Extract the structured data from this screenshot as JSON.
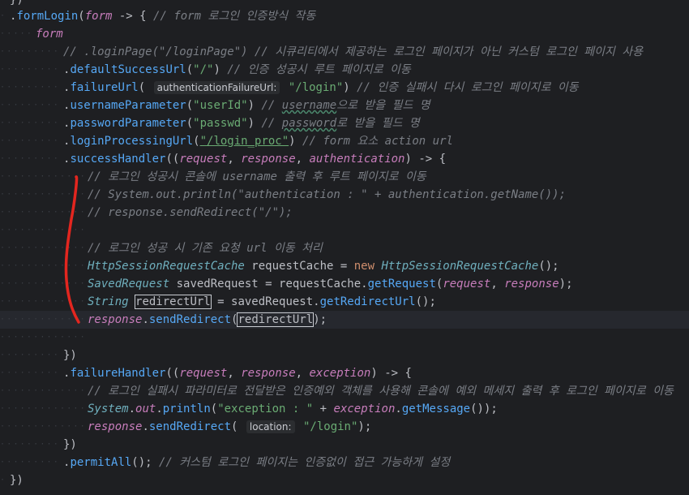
{
  "code_lines": [
    {
      "id": "l0",
      "parts": [
        {
          "t": "})",
          "c": "c-var"
        }
      ]
    },
    {
      "id": "l1",
      "parts": [
        {
          "t": ".",
          "c": "c-var"
        },
        {
          "t": "formLogin",
          "c": "c-meth"
        },
        {
          "t": "(",
          "c": "c-var"
        },
        {
          "t": "form",
          "c": "c-param"
        },
        {
          "t": " -> { ",
          "c": "c-var"
        },
        {
          "t": "// form 로그인 인증방식 작동",
          "c": "c-cmt"
        }
      ]
    },
    {
      "id": "l2",
      "parts": [
        {
          "t": "form",
          "c": "c-param"
        }
      ]
    },
    {
      "id": "l3",
      "parts": [
        {
          "t": "// .loginPage(\"/loginPage\") // 시큐리티에서 제공하는 로그인 페이지가 아닌 커스텀 로그인 페이지 사용",
          "c": "c-cmt"
        }
      ]
    },
    {
      "id": "l4",
      "parts": [
        {
          "t": ".",
          "c": "c-var"
        },
        {
          "t": "defaultSuccessUrl",
          "c": "c-meth"
        },
        {
          "t": "(",
          "c": "c-var"
        },
        {
          "t": "\"/\"",
          "c": "c-str"
        },
        {
          "t": ") ",
          "c": "c-var"
        },
        {
          "t": "// 인증 성공시 루트 페이지로 이동",
          "c": "c-cmt"
        }
      ]
    },
    {
      "id": "l5",
      "parts": [
        {
          "t": ".",
          "c": "c-var"
        },
        {
          "t": "failureUrl",
          "c": "c-meth"
        },
        {
          "t": "( ",
          "c": "c-var"
        },
        {
          "hint": "authenticationFailureUrl:"
        },
        {
          "t": " \"/login\"",
          "c": "c-str"
        },
        {
          "t": ") ",
          "c": "c-var"
        },
        {
          "t": "// 인증 실패시 다시 로그인 페이지로 이동",
          "c": "c-cmt"
        }
      ]
    },
    {
      "id": "l6",
      "parts": [
        {
          "t": ".",
          "c": "c-var"
        },
        {
          "t": "usernameParameter",
          "c": "c-meth"
        },
        {
          "t": "(",
          "c": "c-var"
        },
        {
          "t": "\"userId\"",
          "c": "c-str"
        },
        {
          "t": ") ",
          "c": "c-var"
        },
        {
          "t": "// ",
          "c": "c-cmt"
        },
        {
          "t": "username",
          "c": "c-cmt wavy"
        },
        {
          "t": "으로 받을 필드 명",
          "c": "c-cmt"
        }
      ]
    },
    {
      "id": "l7",
      "parts": [
        {
          "t": ".",
          "c": "c-var"
        },
        {
          "t": "passwordParameter",
          "c": "c-meth"
        },
        {
          "t": "(",
          "c": "c-var"
        },
        {
          "t": "\"passwd\"",
          "c": "c-str"
        },
        {
          "t": ") ",
          "c": "c-var"
        },
        {
          "t": "// ",
          "c": "c-cmt"
        },
        {
          "t": "password",
          "c": "c-cmt wavy"
        },
        {
          "t": "로 받을 필드 명",
          "c": "c-cmt"
        }
      ]
    },
    {
      "id": "l8",
      "parts": [
        {
          "t": ".",
          "c": "c-var"
        },
        {
          "t": "loginProcessingUrl",
          "c": "c-meth"
        },
        {
          "t": "(",
          "c": "c-var"
        },
        {
          "t": "\"/login_proc\"",
          "c": "c-str under"
        },
        {
          "t": ") ",
          "c": "c-var"
        },
        {
          "t": "// form 요소 action url",
          "c": "c-cmt"
        }
      ]
    },
    {
      "id": "l9",
      "parts": [
        {
          "t": ".",
          "c": "c-var"
        },
        {
          "t": "successHandler",
          "c": "c-meth"
        },
        {
          "t": "((",
          "c": "c-var"
        },
        {
          "t": "request",
          "c": "c-param"
        },
        {
          "t": ", ",
          "c": "c-var"
        },
        {
          "t": "response",
          "c": "c-param"
        },
        {
          "t": ", ",
          "c": "c-var"
        },
        {
          "t": "authentication",
          "c": "c-param"
        },
        {
          "t": ") -> {",
          "c": "c-var"
        }
      ]
    },
    {
      "id": "l10",
      "parts": [
        {
          "t": "// 로그인 성공시 콘솔에 username 출력 후 루트 페이지로 이동",
          "c": "c-cmt"
        }
      ]
    },
    {
      "id": "l11",
      "parts": [
        {
          "t": "// System.out.println(\"authentication : \" + authentication.getName());",
          "c": "c-cmt"
        }
      ]
    },
    {
      "id": "l12",
      "parts": [
        {
          "t": "// response.sendRedirect(\"/\");",
          "c": "c-cmt"
        }
      ]
    },
    {
      "id": "l13",
      "parts": []
    },
    {
      "id": "l14",
      "parts": [
        {
          "t": "// 로그인 성공 시 기존 요청 url 이동 처리",
          "c": "c-cmt"
        }
      ]
    },
    {
      "id": "l15",
      "parts": [
        {
          "t": "HttpSessionRequestCache",
          "c": "c-cls"
        },
        {
          "t": " requestCache = ",
          "c": "c-var"
        },
        {
          "t": "new ",
          "c": "c-key"
        },
        {
          "t": "HttpSessionRequestCache",
          "c": "c-cls"
        },
        {
          "t": "();",
          "c": "c-var"
        }
      ]
    },
    {
      "id": "l16",
      "parts": [
        {
          "t": "SavedRequest",
          "c": "c-cls"
        },
        {
          "t": " savedRequest = requestCache.",
          "c": "c-var"
        },
        {
          "t": "getRequest",
          "c": "c-meth"
        },
        {
          "t": "(",
          "c": "c-var"
        },
        {
          "t": "request",
          "c": "c-param"
        },
        {
          "t": ", ",
          "c": "c-var"
        },
        {
          "t": "response",
          "c": "c-param"
        },
        {
          "t": ");",
          "c": "c-var"
        }
      ]
    },
    {
      "id": "l17",
      "parts": [
        {
          "t": "String",
          "c": "c-cls"
        },
        {
          "t": " ",
          "c": "c-var"
        },
        {
          "t": "redirectUrl",
          "c": "c-var boxed"
        },
        {
          "t": " = savedRequest.",
          "c": "c-var"
        },
        {
          "t": "getRedirectUrl",
          "c": "c-meth"
        },
        {
          "t": "();",
          "c": "c-var"
        }
      ]
    },
    {
      "id": "l18",
      "parts": [
        {
          "t": "response",
          "c": "c-param"
        },
        {
          "t": ".",
          "c": "c-var"
        },
        {
          "t": "sendRedirect",
          "c": "c-meth"
        },
        {
          "t": "(",
          "c": "c-var"
        },
        {
          "t": "redirectUrl",
          "c": "c-var boxed"
        },
        {
          "t": ");",
          "c": "c-var"
        }
      ]
    },
    {
      "id": "l19",
      "parts": []
    },
    {
      "id": "l20",
      "parts": [
        {
          "t": "})",
          "c": "c-var"
        }
      ]
    },
    {
      "id": "l21",
      "parts": [
        {
          "t": ".",
          "c": "c-var"
        },
        {
          "t": "failureHandler",
          "c": "c-meth"
        },
        {
          "t": "((",
          "c": "c-var"
        },
        {
          "t": "request",
          "c": "c-param"
        },
        {
          "t": ", ",
          "c": "c-var"
        },
        {
          "t": "response",
          "c": "c-param"
        },
        {
          "t": ", ",
          "c": "c-var"
        },
        {
          "t": "exception",
          "c": "c-param"
        },
        {
          "t": ") -> {",
          "c": "c-var"
        }
      ]
    },
    {
      "id": "l22",
      "parts": [
        {
          "t": "// 로그인 실패시 파라미터로 전달받은 인증예외 객체를 사용해 콘솔에 예외 메세지 출력 후 로그인 페이지로 이동",
          "c": "c-cmt"
        }
      ]
    },
    {
      "id": "l23",
      "parts": [
        {
          "t": "System",
          "c": "c-cls"
        },
        {
          "t": ".",
          "c": "c-var"
        },
        {
          "t": "out",
          "c": "c-static"
        },
        {
          "t": ".",
          "c": "c-var"
        },
        {
          "t": "println",
          "c": "c-meth"
        },
        {
          "t": "(",
          "c": "c-var"
        },
        {
          "t": "\"exception : \"",
          "c": "c-str"
        },
        {
          "t": " + ",
          "c": "c-var"
        },
        {
          "t": "exception",
          "c": "c-param"
        },
        {
          "t": ".",
          "c": "c-var"
        },
        {
          "t": "getMessage",
          "c": "c-meth"
        },
        {
          "t": "());",
          "c": "c-var"
        }
      ]
    },
    {
      "id": "l24",
      "parts": [
        {
          "t": "response",
          "c": "c-param"
        },
        {
          "t": ".",
          "c": "c-var"
        },
        {
          "t": "sendRedirect",
          "c": "c-meth"
        },
        {
          "t": "( ",
          "c": "c-var"
        },
        {
          "hint": "location:"
        },
        {
          "t": " \"/login\"",
          "c": "c-str"
        },
        {
          "t": ");",
          "c": "c-var"
        }
      ]
    },
    {
      "id": "l25",
      "parts": [
        {
          "t": "})",
          "c": "c-var"
        }
      ]
    },
    {
      "id": "l26",
      "parts": [
        {
          "t": ".",
          "c": "c-var"
        },
        {
          "t": "permitAll",
          "c": "c-meth"
        },
        {
          "t": "(); ",
          "c": "c-var"
        },
        {
          "t": "// 커스텀 로그인 페이지는 인증없이 접근 가능하게 설정",
          "c": "c-cmt"
        }
      ]
    },
    {
      "id": "l27",
      "parts": [
        {
          "t": "})",
          "c": "c-var"
        }
      ]
    }
  ],
  "colors": {
    "background": "#1e1f22",
    "comment": "#7a7e85",
    "method": "#56a8f5",
    "string": "#6aab73",
    "keyword": "#cf8e6d",
    "parameter": "#c77dbb",
    "class": "#6fafbd",
    "annotation_stroke": "#e3261f"
  },
  "annotation": {
    "type": "hand-drawn-bracket",
    "color": "#e3261f"
  }
}
